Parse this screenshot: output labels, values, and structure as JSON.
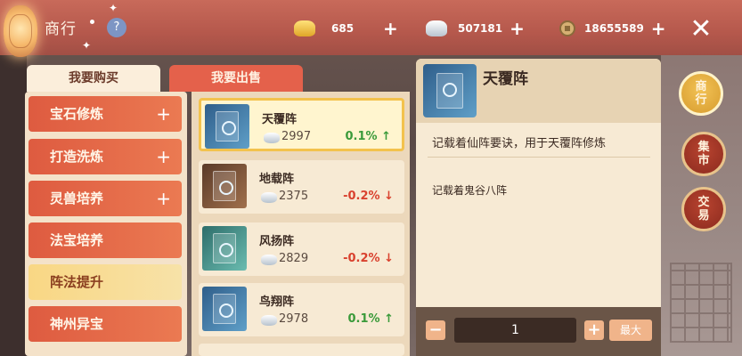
{
  "header": {
    "title": "商行",
    "help": "?",
    "currencies": [
      {
        "icon": "gold-ingot-icon",
        "value": "685"
      },
      {
        "icon": "silver-ingot-icon",
        "value": "507181"
      },
      {
        "icon": "coin-icon",
        "value": "18655589"
      }
    ],
    "plus": "+",
    "close": "✕"
  },
  "tabs": {
    "buy": "我要购买",
    "sell": "我要出售"
  },
  "categories": [
    {
      "label": "宝石修炼",
      "plus": "+"
    },
    {
      "label": "打造洗炼",
      "plus": "+"
    },
    {
      "label": "灵兽培养",
      "plus": "+"
    },
    {
      "label": "法宝培养",
      "plus": ""
    },
    {
      "label": "阵法提升",
      "plus": ""
    },
    {
      "label": "神州异宝",
      "plus": ""
    }
  ],
  "items": [
    {
      "name": "天覆阵",
      "price": "2997",
      "change": "0.1%",
      "arrow": "↑"
    },
    {
      "name": "地载阵",
      "price": "2375",
      "change": "-0.2%",
      "arrow": "↓"
    },
    {
      "name": "风扬阵",
      "price": "2829",
      "change": "-0.2%",
      "arrow": "↓"
    },
    {
      "name": "鸟翔阵",
      "price": "2978",
      "change": "0.1%",
      "arrow": "↑"
    }
  ],
  "detail": {
    "name": "天覆阵",
    "description": "记载着仙阵要诀，用于天覆阵修炼",
    "note": "记载着鬼谷八阵"
  },
  "quantity": {
    "minus": "−",
    "value": "1",
    "plus": "+",
    "max": "最大"
  },
  "side_nav": [
    {
      "label": "商行"
    },
    {
      "label": "集市"
    },
    {
      "label": "交易"
    }
  ]
}
